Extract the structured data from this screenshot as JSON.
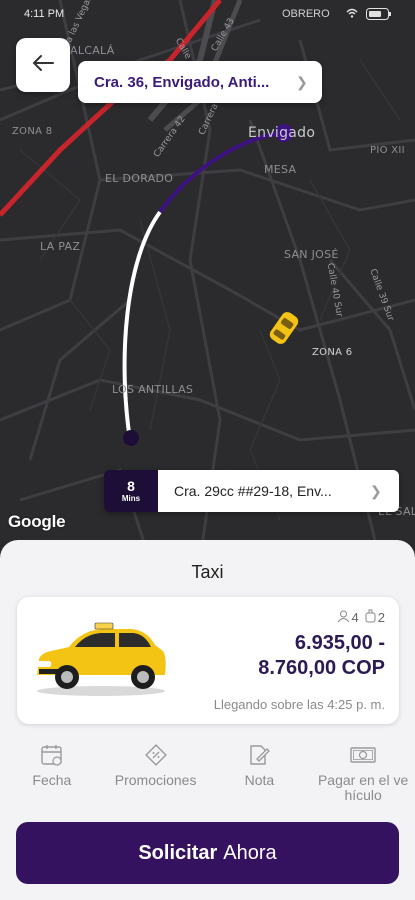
{
  "status_bar": {
    "time": "4:11 PM",
    "carrier": "OBRERO"
  },
  "map": {
    "labels": [
      "ALCALÁ",
      "ZONA 8",
      "EL DORADO",
      "LA PAZ",
      "LOS ANTILLAS",
      "MESA",
      "SAN JOSÉ",
      "ZONA 6",
      "PIO XII",
      "Envigado",
      "EL SAL"
    ],
    "streets": [
      "Calle 43",
      "Calle 42",
      "Carrera 42",
      "Carrera 43",
      "Calle 40 Sur",
      "Calle 39 Sur",
      "Via las Vegas"
    ],
    "attribution": "Google"
  },
  "pickup": {
    "address": "Cra. 36, Envigado, Anti..."
  },
  "destination": {
    "eta_value": "8",
    "eta_unit": "Mins",
    "address": "Cra. 29cc ##29-18, Env..."
  },
  "ride": {
    "title": "Taxi",
    "passengers": "4",
    "luggage": "2",
    "price_line1": "6.935,00 -",
    "price_line2": "8.760,00 COP",
    "arrival": "Llegando sobre las 4:25 p. m."
  },
  "options": [
    {
      "label": "Fecha",
      "icon": "calendar-icon"
    },
    {
      "label": "Promociones",
      "icon": "promo-tag-icon"
    },
    {
      "label": "Nota",
      "icon": "note-pencil-icon"
    },
    {
      "label": "Pagar en el vehículo",
      "icon": "cash-icon"
    }
  ],
  "action": {
    "bold": "Solicitar",
    "rest": "Ahora"
  },
  "colors": {
    "brand": "#35125f",
    "route_purple": "#3d1283",
    "map_bg": "#2b2b2d",
    "red_road": "#c7252b"
  }
}
